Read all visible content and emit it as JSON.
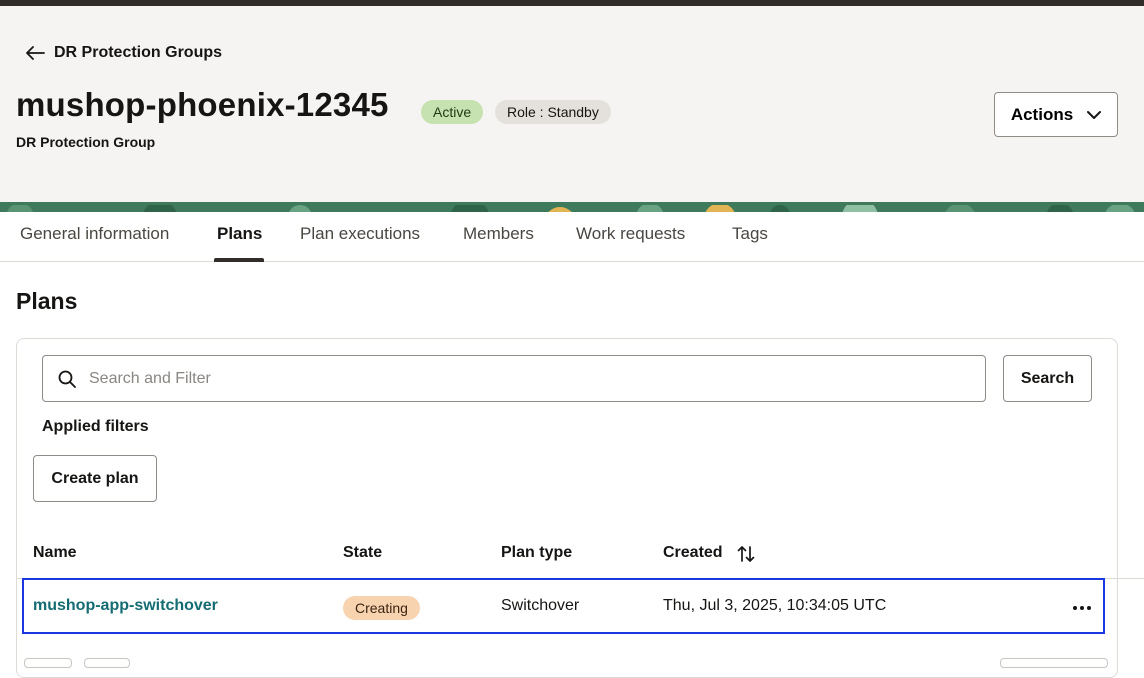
{
  "breadcrumb": {
    "back_label": "DR Protection Groups"
  },
  "header": {
    "title": "mushop-phoenix-12345",
    "subtitle": "DR Protection Group",
    "status_badge": "Active",
    "role_badge": "Role : Standby",
    "actions_label": "Actions"
  },
  "tabs": [
    {
      "label": "General information"
    },
    {
      "label": "Plans",
      "active": true
    },
    {
      "label": "Plan executions"
    },
    {
      "label": "Members"
    },
    {
      "label": "Work requests"
    },
    {
      "label": "Tags"
    }
  ],
  "plans": {
    "title": "Plans",
    "search_placeholder": "Search and Filter",
    "search_button": "Search",
    "applied_filters": "Applied filters",
    "create_button": "Create plan",
    "columns": [
      "Name",
      "State",
      "Plan type",
      "Created"
    ],
    "rows": [
      {
        "name": "mushop-app-switchover",
        "state": "Creating",
        "plan_type": "Switchover",
        "created": "Thu, Jul 3, 2025, 10:34:05 UTC"
      }
    ]
  },
  "icons": {
    "back": "arrow-left-icon",
    "actions": "chevron-down-icon",
    "search": "search-icon",
    "sort": "sort-icon",
    "row_menu": "more-horizontal-icon"
  },
  "colors": {
    "active_badge": "#c5e2b0",
    "creating_badge": "#f7d3b0",
    "link": "#146c72",
    "selection": "#1a37e0"
  }
}
